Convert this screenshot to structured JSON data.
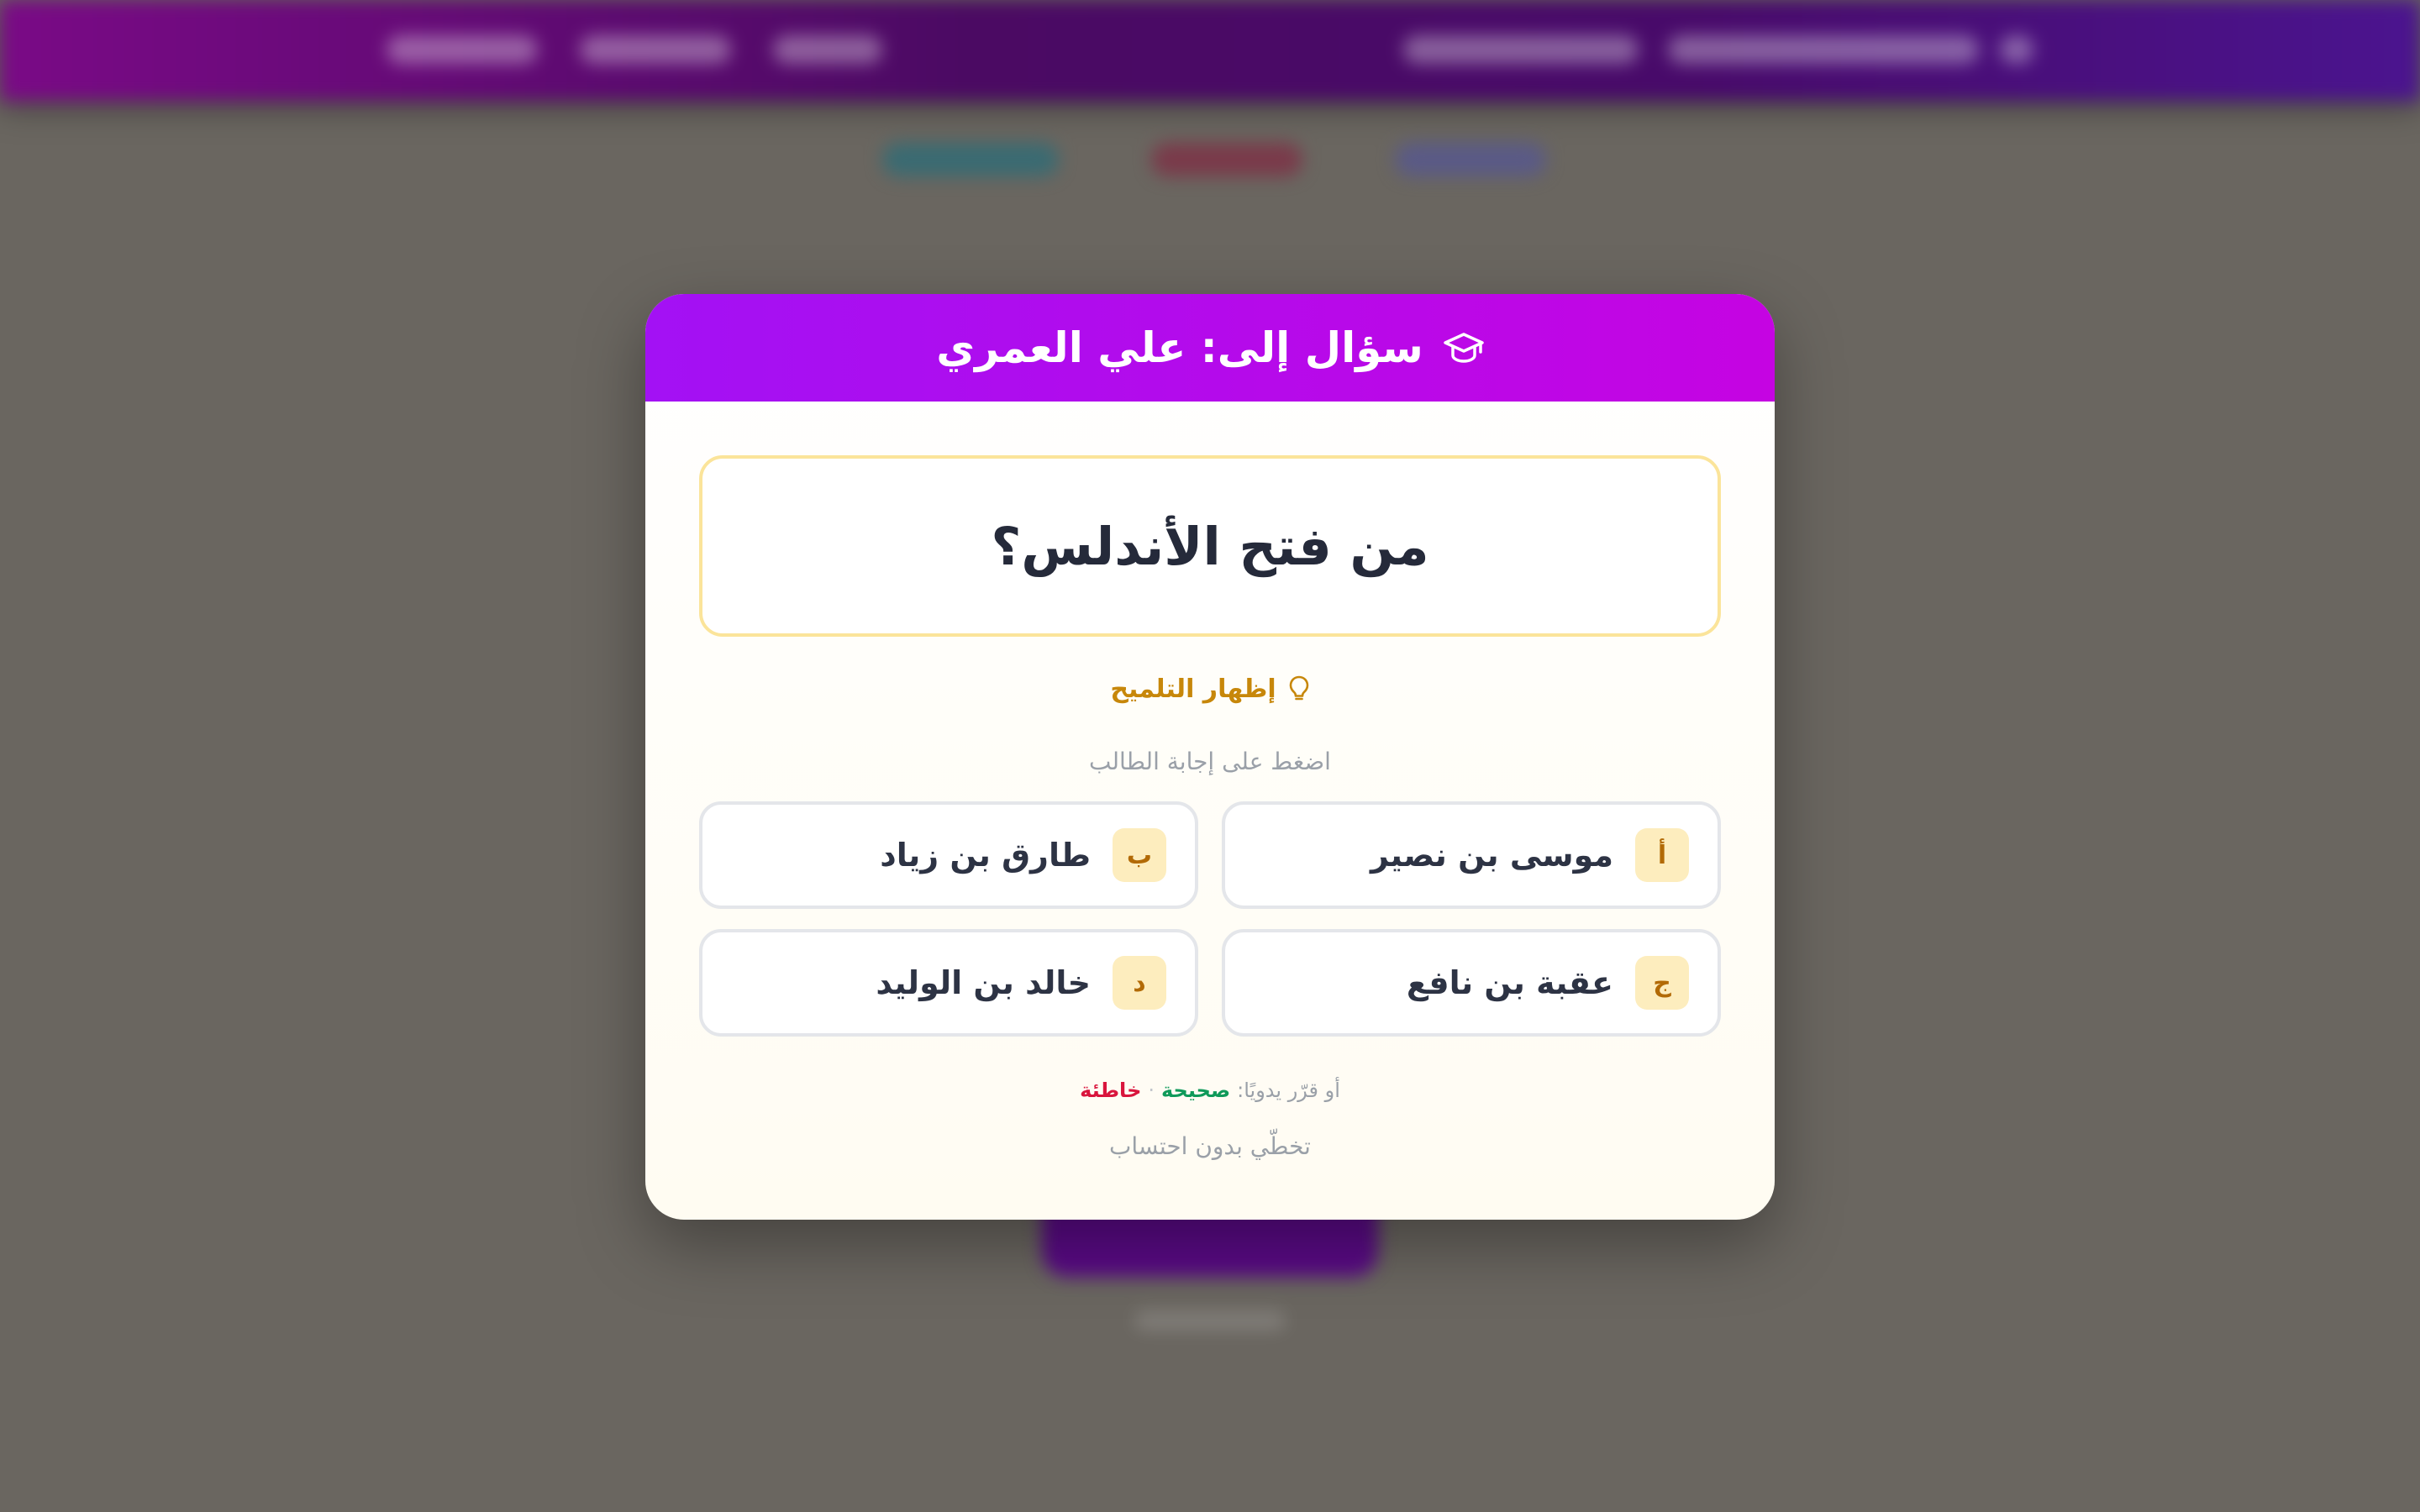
{
  "colors": {
    "header_gradient_start": "#c504e2",
    "header_gradient_end": "#a311f4",
    "question_border": "#fbe49a",
    "hint": "#c7870a",
    "option_letter_bg": "#fdedbe",
    "correct": "#0f9a5a",
    "wrong": "#d9153d",
    "overlay": "#6a6660"
  },
  "modal": {
    "header_icon": "graduation-cap-icon",
    "title": "سؤال إلى: علي العمري",
    "question": "من فتح الأندلس؟",
    "hint_icon": "lightbulb-icon",
    "hint_label": "إظهار التلميح",
    "instruction": "اضغط على إجابة الطالب",
    "options": [
      {
        "letter": "أ",
        "text": "موسى بن نصير"
      },
      {
        "letter": "ب",
        "text": "طارق بن زياد"
      },
      {
        "letter": "ج",
        "text": "عقبة بن نافع"
      },
      {
        "letter": "د",
        "text": "خالد بن الوليد"
      }
    ],
    "manual": {
      "prefix": "أو قرّر يدويًا:",
      "correct": "صحيحة",
      "separator": "·",
      "wrong": "خاطئة"
    },
    "skip": "تخطّي بدون احتساب"
  }
}
